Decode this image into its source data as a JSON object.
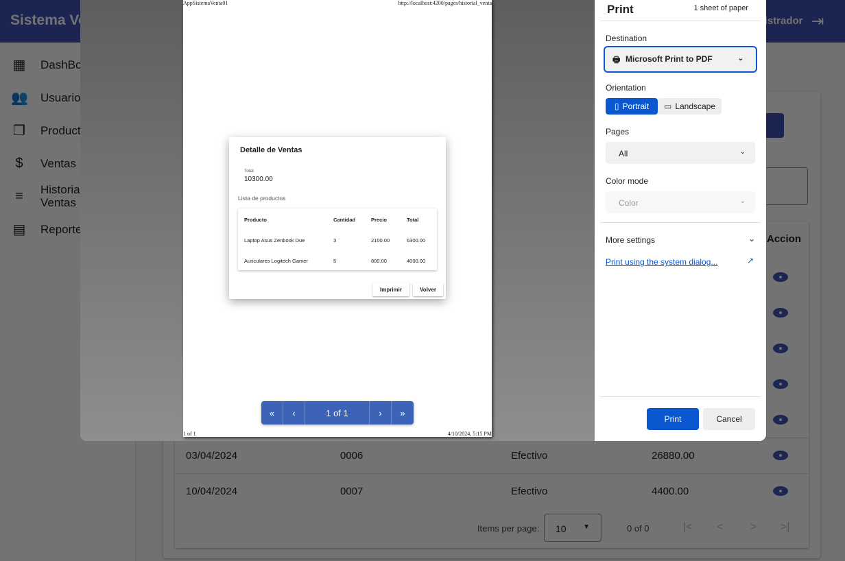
{
  "app": {
    "title": "Sistema Ventas",
    "user": "Administrador",
    "logout_icon": "logout-icon"
  },
  "sidebar": {
    "items": [
      {
        "label": "DashBoard",
        "icon": "dashboard-icon"
      },
      {
        "label": "Usuarios",
        "icon": "people-icon"
      },
      {
        "label": "Productos",
        "icon": "library-icon"
      },
      {
        "label": "Ventas",
        "icon": "currency-exchange-icon"
      },
      {
        "label": "Historial Ventas",
        "icon": "edit-note-icon"
      },
      {
        "label": "Reportes",
        "icon": "receipt-icon"
      }
    ]
  },
  "table": {
    "action_header": "Accion",
    "rows": [
      {
        "date": "03/04/2024",
        "number": "0006",
        "payment": "Efectivo",
        "total": "26880.00"
      },
      {
        "date": "10/04/2024",
        "number": "0007",
        "payment": "Efectivo",
        "total": "4400.00"
      }
    ],
    "paginator": {
      "items_per_page_label": "Items per page:",
      "items_per_page": "10",
      "range": "0 of 0"
    }
  },
  "print_preview": {
    "header_left": "AppSistemaVenta01",
    "header_right": "http://localhost:4200/pages/historial_venta",
    "footer_left": "1 of 1",
    "footer_right": "4/10/2024, 5:15 PM",
    "modal": {
      "title": "Detalle de Ventas",
      "total_label": "Total",
      "total_value": "10300.00",
      "list_label": "Lista de productos",
      "columns": [
        "Producto",
        "Cantidad",
        "Precio",
        "Total"
      ],
      "rows": [
        [
          "Laptop Asus Zenbook Due",
          "3",
          "2100.00",
          "6300.00"
        ],
        [
          "Auriculares Logitech Gamer",
          "5",
          "800.00",
          "4000.00"
        ]
      ],
      "print_button": "Imprimir",
      "back_button": "Volver"
    },
    "page_indicator": "1 of 1"
  },
  "print_settings": {
    "title": "Print",
    "sheets": "1 sheet of paper",
    "destination_label": "Destination",
    "destination": "Microsoft Print to PDF",
    "orientation_label": "Orientation",
    "portrait": "Portrait",
    "landscape": "Landscape",
    "orientation_selected": "Portrait",
    "pages_label": "Pages",
    "pages": "All",
    "color_label": "Color mode",
    "color": "Color",
    "more_settings": "More settings",
    "system_dialog": "Print using the system dialog...",
    "print_button": "Print",
    "cancel_button": "Cancel",
    "accent": "#0b57d0"
  }
}
